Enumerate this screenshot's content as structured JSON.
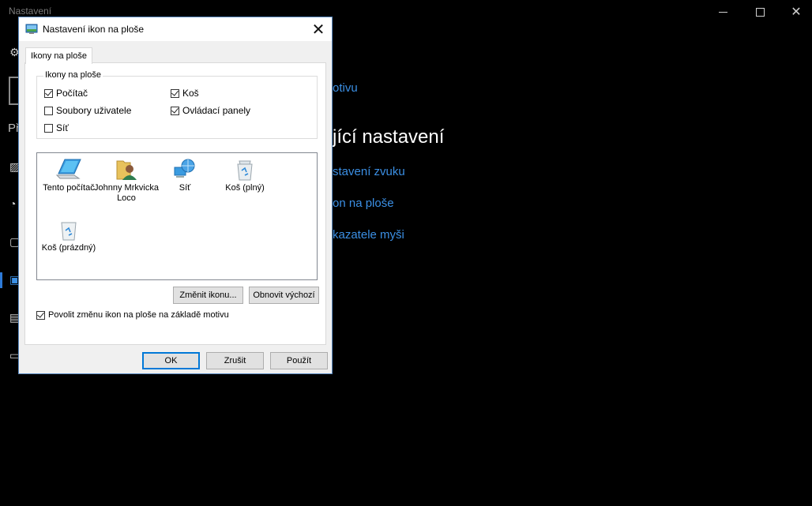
{
  "background": {
    "app_title": "Nastavení",
    "left_label": "Př",
    "heading": "jící nastavení",
    "links": [
      "otivu",
      "stavení zvuku",
      "on na ploše",
      "kazatele myši"
    ],
    "accent_color": "#3b8fe4"
  },
  "dialog": {
    "title": "Nastavení ikon na ploše",
    "tab_label": "Ikony na ploše",
    "group_label": "Ikony na ploše",
    "checkboxes": [
      {
        "label": "Počítač",
        "checked": true
      },
      {
        "label": "Koš",
        "checked": true
      },
      {
        "label": "Soubory uživatele",
        "checked": false
      },
      {
        "label": "Ovládací panely",
        "checked": true
      },
      {
        "label": "Síť",
        "checked": false
      }
    ],
    "icons": [
      {
        "label": "Tento počítač",
        "icon": "computer-icon"
      },
      {
        "label": "Johnny Mrkvicka Loco",
        "icon": "user-folder-icon"
      },
      {
        "label": "Síť",
        "icon": "network-icon"
      },
      {
        "label": "Koš (plný)",
        "icon": "recycle-bin-full-icon"
      },
      {
        "label": "Koš (prázdný)",
        "icon": "recycle-bin-empty-icon"
      }
    ],
    "change_icon_label": "Změnit ikonu...",
    "restore_default_label": "Obnovit výchozí",
    "allow_themes_label": "Povolit změnu ikon na ploše na základě motivu",
    "allow_themes_checked": true,
    "ok_label": "OK",
    "cancel_label": "Zrušit",
    "apply_label": "Použít"
  }
}
